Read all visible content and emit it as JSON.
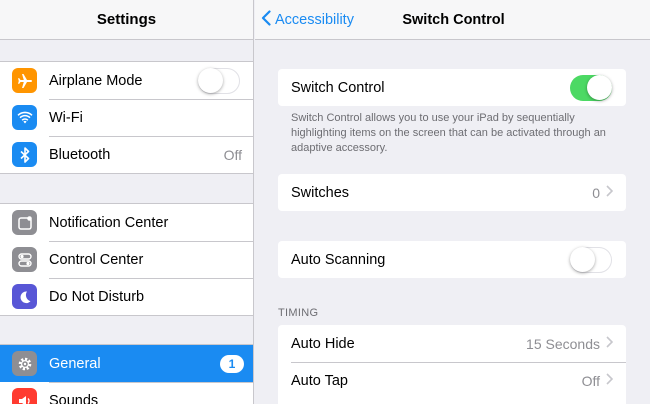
{
  "sidebar": {
    "title": "Settings",
    "groups": [
      {
        "items": [
          {
            "label": "Airplane Mode",
            "icon": "airplane-icon",
            "icon_color": "#ff9500",
            "control": "toggle",
            "toggle_on": false
          },
          {
            "label": "Wi-Fi",
            "icon": "wifi-icon",
            "icon_color": "#1a8bf2",
            "value": ""
          },
          {
            "label": "Bluetooth",
            "icon": "bluetooth-icon",
            "icon_color": "#1a8bf2",
            "value": "Off"
          }
        ]
      },
      {
        "items": [
          {
            "label": "Notification Center",
            "icon": "notification-center-icon",
            "icon_color": "#8e8e93"
          },
          {
            "label": "Control Center",
            "icon": "control-center-icon",
            "icon_color": "#8e8e93"
          },
          {
            "label": "Do Not Disturb",
            "icon": "moon-icon",
            "icon_color": "#5856d6"
          }
        ]
      },
      {
        "items": [
          {
            "label": "General",
            "icon": "gear-icon",
            "icon_color": "#8e8e93",
            "badge": "1",
            "selected": true
          },
          {
            "label": "Sounds",
            "icon": "speaker-icon",
            "icon_color": "#ff3b30"
          }
        ]
      }
    ]
  },
  "main": {
    "back_label": "Accessibility",
    "title": "Switch Control",
    "switch_control": {
      "label": "Switch Control",
      "toggle_on": true
    },
    "description": "Switch Control allows you to use your iPad by sequentially highlighting items on the screen that can be activated through an adaptive accessory.",
    "switches": {
      "label": "Switches",
      "value": "0"
    },
    "auto_scanning": {
      "label": "Auto Scanning",
      "toggle_on": false
    },
    "timing_header": "TIMING",
    "timing": [
      {
        "label": "Auto Hide",
        "value": "15 Seconds"
      },
      {
        "label": "Auto Tap",
        "value": "Off"
      }
    ]
  },
  "colors": {
    "accent": "#1a8bf2",
    "toggle_on": "#4cd964",
    "background": "#efeff4"
  }
}
